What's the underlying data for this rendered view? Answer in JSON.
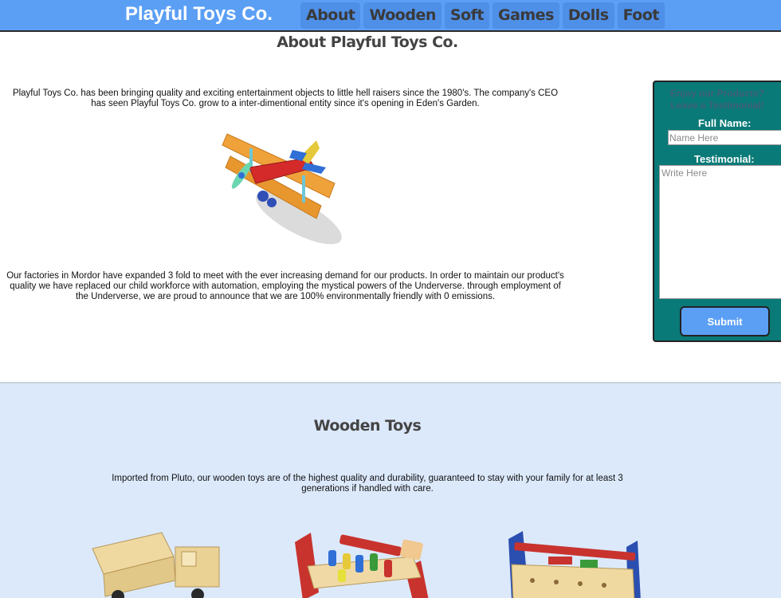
{
  "nav": {
    "brand": "Playful Toys Co.",
    "links": [
      "About",
      "Wooden",
      "Soft",
      "Games",
      "Dolls",
      "Foot"
    ]
  },
  "about": {
    "title": "About Playful Toys Co.",
    "p1": "Playful Toys Co. has been bringing quality and exciting entertainment objects to little hell raisers since the 1980's. The company's CEO has seen Playful Toys Co. grow to a inter-dimentional entity since it's opening in Eden's Garden.",
    "p2": "Our factories in Mordor have expanded 3 fold to meet with the ever increasing demand for our products. In order to maintain our product's quality we have replaced our child workforce with automation, employing the mystical powers of the Underverse. through employment of the Underverse, we are proud to announce that we are 100% environmentally friendly with 0 emissions."
  },
  "testimonial": {
    "heading_line1": "Enjoy our Products?",
    "heading_line2": "Leave a Testimonial!",
    "name_label": "Full Name:",
    "name_placeholder": "Name Here",
    "name_value": "",
    "testimonial_label": "Testimonial:",
    "testimonial_placeholder": "Write Here",
    "submit_label": "Submit"
  },
  "wooden": {
    "title": "Wooden Toys",
    "description": "Imported from Pluto, our wooden toys are of the highest quality and durability, guaranteed to stay with your family for at least 3 generations if handled with care."
  },
  "colors": {
    "nav_bg": "#5b9ff5",
    "form_bg": "#0a7a78",
    "section_bg": "#dce9fb"
  }
}
